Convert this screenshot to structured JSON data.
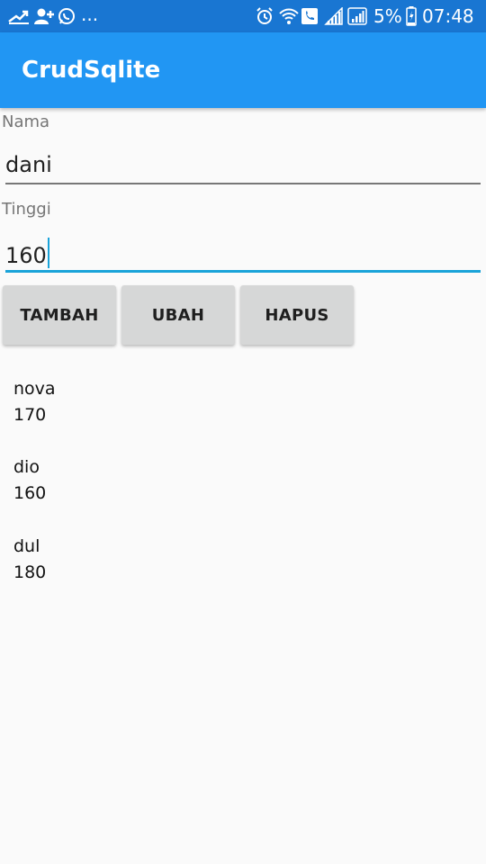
{
  "status_bar": {
    "more_indicator": "...",
    "battery_percent": "5%",
    "time": "07:48",
    "background": "#1976d2"
  },
  "app_bar": {
    "title": "CrudSqlite",
    "background": "#2196f3"
  },
  "form": {
    "nama_label": "Nama",
    "nama_value": "dani",
    "tinggi_label": "Tinggi",
    "tinggi_value": "160",
    "accent": "#1aa3d9"
  },
  "buttons": {
    "tambah": "TAMBAH",
    "ubah": "UBAH",
    "hapus": "HAPUS"
  },
  "records": [
    {
      "nama": "nova",
      "tinggi": "170"
    },
    {
      "nama": "dio",
      "tinggi": "160"
    },
    {
      "nama": "dul",
      "tinggi": "180"
    }
  ]
}
